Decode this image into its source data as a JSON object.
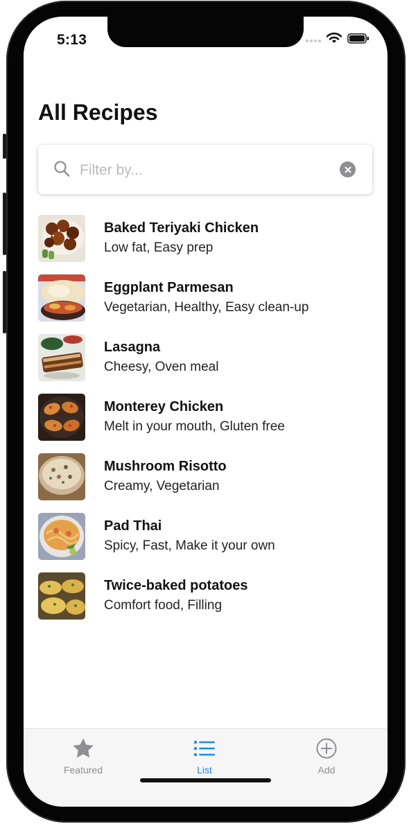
{
  "status_bar": {
    "time": "5:13"
  },
  "header": {
    "title": "All Recipes"
  },
  "search": {
    "placeholder": "Filter by...",
    "value": ""
  },
  "recipes": [
    {
      "name": "Baked Teriyaki Chicken",
      "tags": "Low fat, Easy prep"
    },
    {
      "name": "Eggplant Parmesan",
      "tags": "Vegetarian, Healthy, Easy clean-up"
    },
    {
      "name": "Lasagna",
      "tags": "Cheesy, Oven meal"
    },
    {
      "name": "Monterey Chicken",
      "tags": "Melt in your mouth, Gluten free"
    },
    {
      "name": "Mushroom Risotto",
      "tags": "Creamy, Vegetarian"
    },
    {
      "name": "Pad Thai",
      "tags": "Spicy, Fast, Make it your own"
    },
    {
      "name": "Twice-baked potatoes",
      "tags": "Comfort food, Filling"
    }
  ],
  "tab_bar": {
    "tabs": [
      {
        "label": "Featured",
        "icon": "star-icon",
        "selected": false
      },
      {
        "label": "List",
        "icon": "list-icon",
        "selected": true
      },
      {
        "label": "Add",
        "icon": "plus-circle-icon",
        "selected": false
      }
    ]
  },
  "colors": {
    "accent": "#1e86f0",
    "tab_inactive": "#8e8e93",
    "text": "#111111"
  }
}
